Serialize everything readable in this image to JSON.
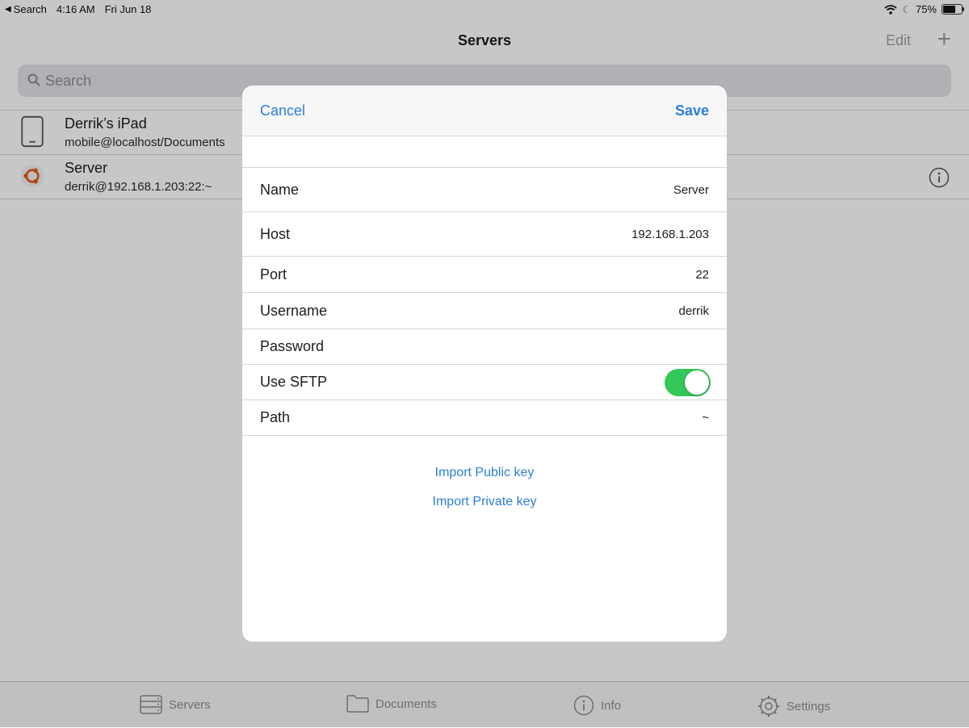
{
  "status_bar": {
    "back_label": "Search",
    "time": "4:16 AM",
    "date": "Fri Jun 18",
    "battery": "75%",
    "battery_level": 0.75
  },
  "nav": {
    "title": "Servers",
    "edit_label": "Edit",
    "add_label": "+"
  },
  "search": {
    "placeholder": "Search"
  },
  "servers": [
    {
      "icon": "ipad-icon",
      "title": "Derrik’s iPad",
      "subtitle": "mobile@localhost/Documents"
    },
    {
      "icon": "ubuntu-icon",
      "title": "Server",
      "subtitle": "derrik@192.168.1.203:22:~"
    }
  ],
  "modal": {
    "cancel_label": "Cancel",
    "save_label": "Save",
    "fields": {
      "name": {
        "label": "Name",
        "value": "Server"
      },
      "host": {
        "label": "Host",
        "value": "192.168.1.203"
      },
      "port": {
        "label": "Port",
        "value": "22"
      },
      "username": {
        "label": "Username",
        "value": "derrik"
      },
      "password": {
        "label": "Password",
        "value": ""
      },
      "sftp": {
        "label": "Use SFTP",
        "enabled": true
      },
      "path": {
        "label": "Path",
        "value": "~"
      }
    },
    "import_public": "Import Public key",
    "import_private": "Import Private key"
  },
  "tabs": [
    {
      "label": "Servers",
      "icon": "servers-icon"
    },
    {
      "label": "Documents",
      "icon": "folder-icon"
    },
    {
      "label": "Info",
      "icon": "info-icon"
    },
    {
      "label": "Settings",
      "icon": "gear-icon"
    }
  ],
  "colors": {
    "accent": "#2b7fd6",
    "toggle_on": "#34c759"
  }
}
